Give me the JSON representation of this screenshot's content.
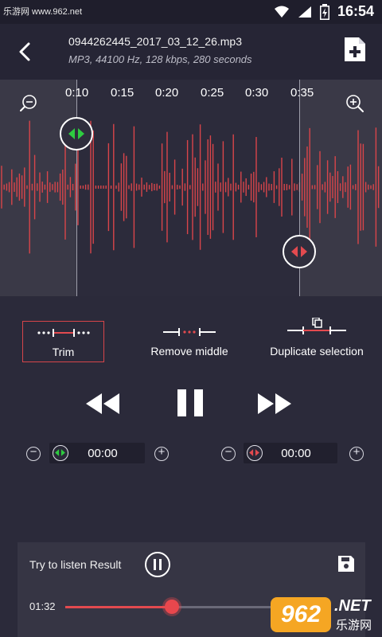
{
  "status_bar": {
    "watermark": "乐游网 www.962.net",
    "time": "16:54"
  },
  "header": {
    "title": "0944262445_2017_03_12_26.mp3",
    "meta": "MP3, 44100 Hz, 128 kbps, 280 seconds"
  },
  "timeline": {
    "ticks": [
      "0:10",
      "0:15",
      "0:20",
      "0:25",
      "0:30",
      "0:35"
    ]
  },
  "modes": {
    "trim": "Trim",
    "remove_middle": "Remove middle",
    "duplicate": "Duplicate selection"
  },
  "start_time": "00:00",
  "end_time": "00:00",
  "result": {
    "label": "Try to listen Result",
    "current_time": "01:32",
    "progress": 0.42
  },
  "watermark_logo": {
    "badge": "962",
    "net": ".NET",
    "cn": "乐游网"
  },
  "colors": {
    "accent": "#e34a4f",
    "green": "#2ecc40",
    "background": "#2b2a3a"
  },
  "icons": [
    "wifi-icon",
    "signal-icon",
    "battery-icon",
    "back-arrow-icon",
    "new-file-icon",
    "zoom-out-icon",
    "zoom-in-icon",
    "rewind-icon",
    "pause-icon",
    "fast-forward-icon",
    "minus-icon",
    "plus-icon",
    "save-icon"
  ]
}
